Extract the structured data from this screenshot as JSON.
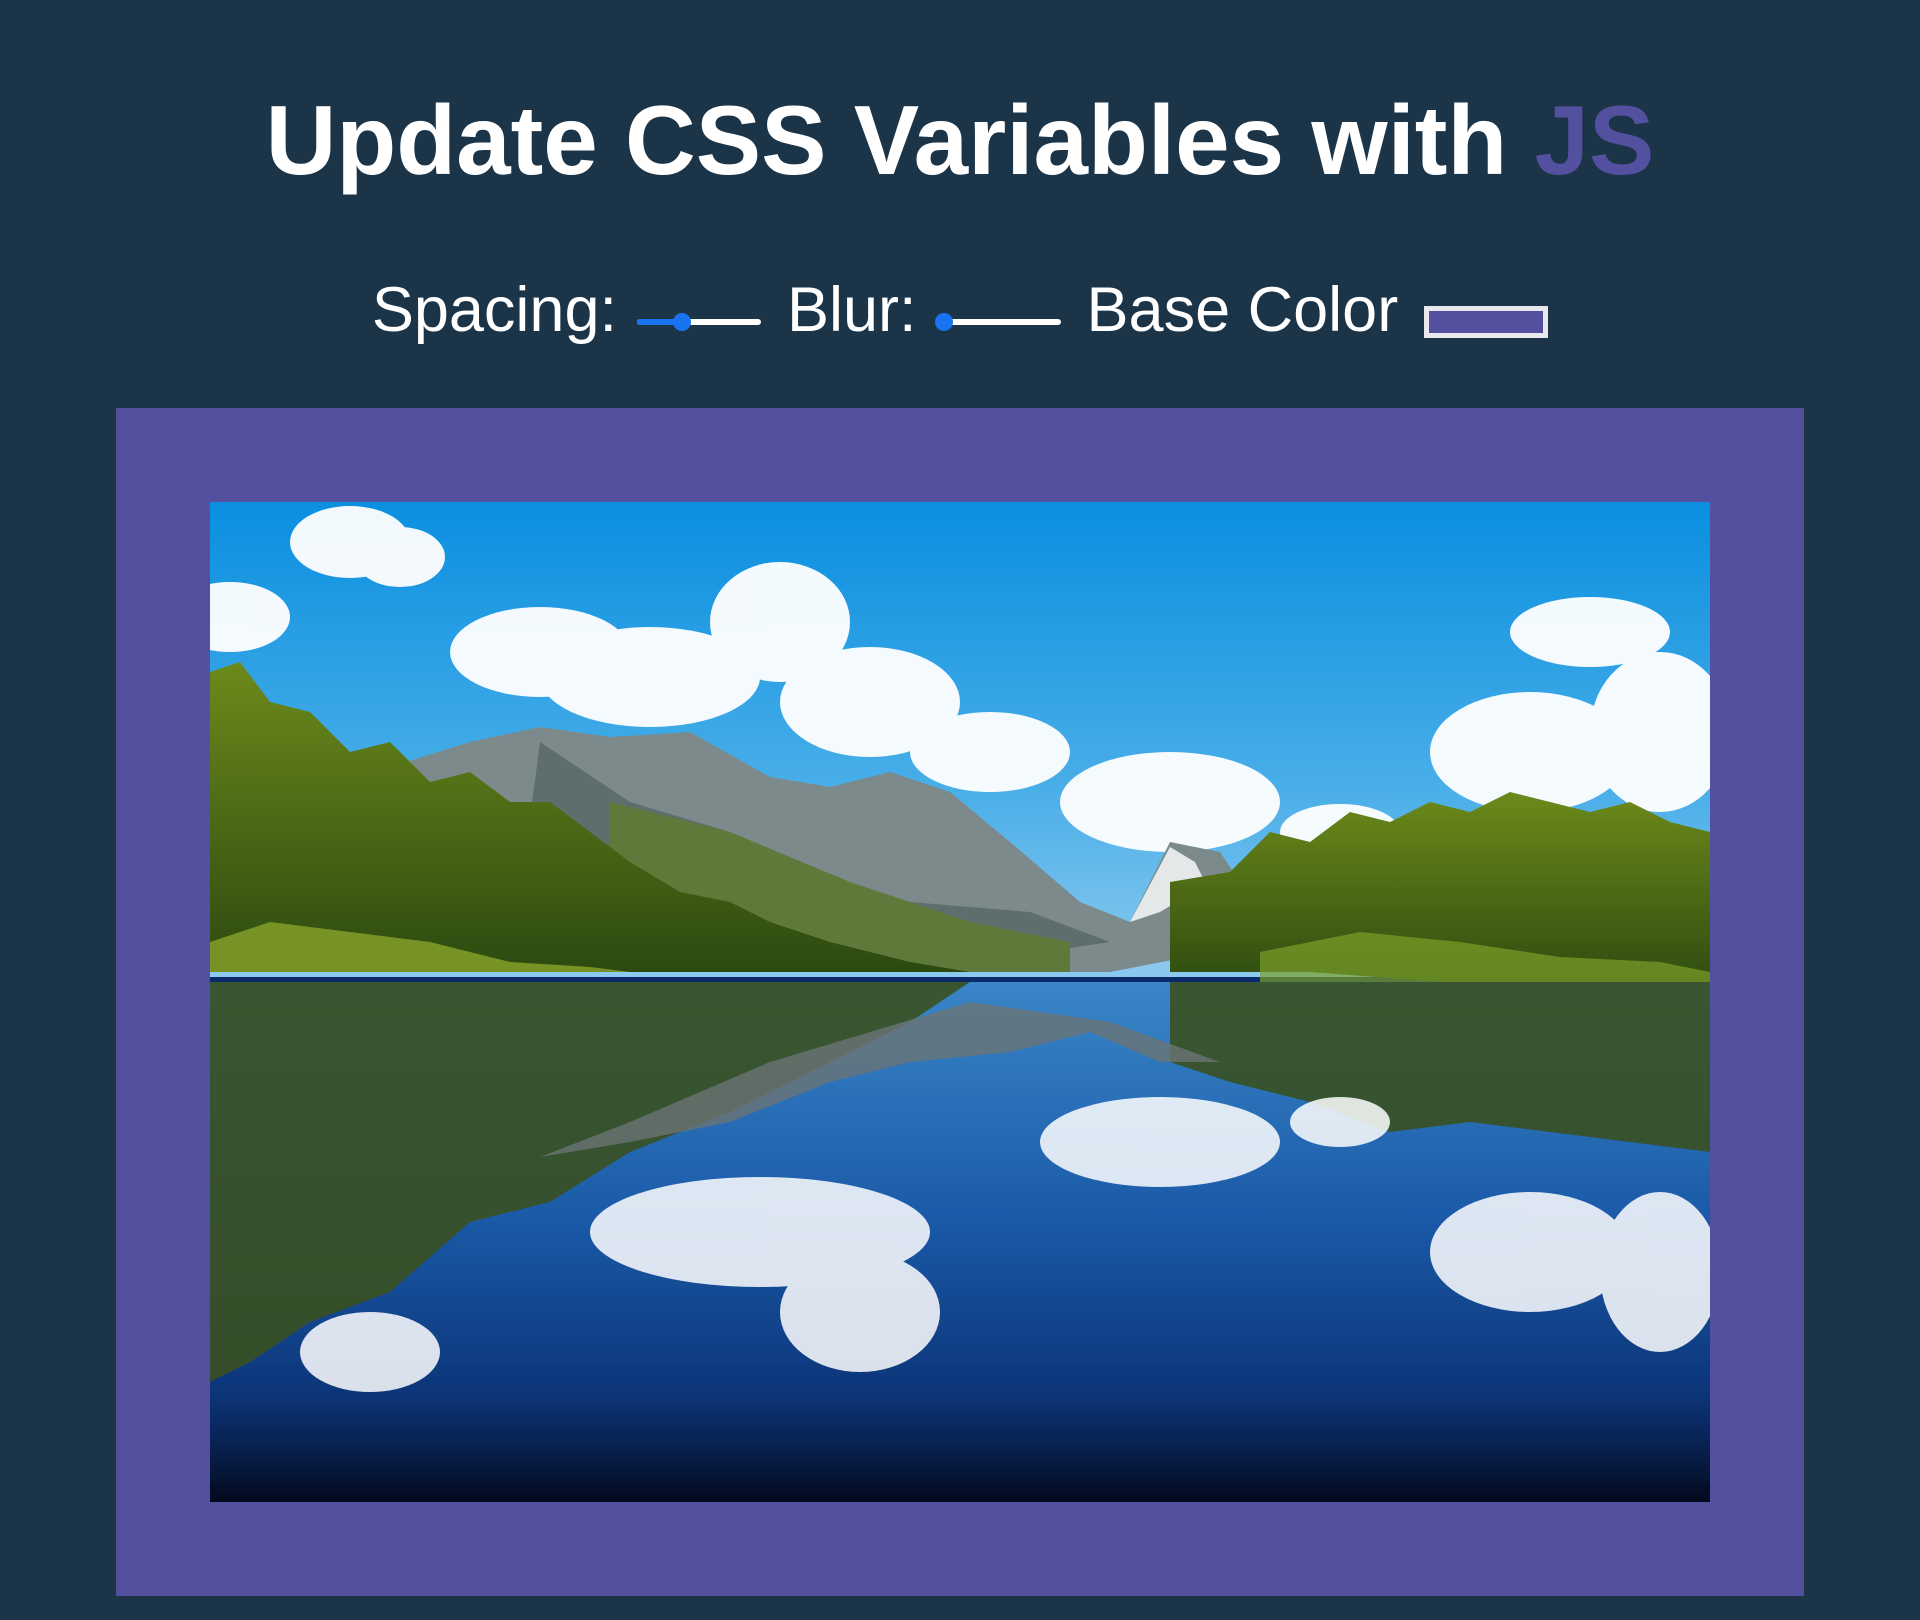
{
  "page": {
    "title_main": "Update CSS Variables with ",
    "title_highlight": "JS"
  },
  "controls": {
    "spacing": {
      "label": "Spacing:",
      "value_fraction": 0.36
    },
    "blur": {
      "label": "Blur:",
      "value_fraction": 0.06
    },
    "base_color": {
      "label": "Base Color",
      "value": "#5450a0"
    }
  },
  "colors": {
    "background": "#1b3448",
    "accent": "#5450a0",
    "slider_active": "#1873f0",
    "text": "#ffffff"
  },
  "image": {
    "subject": "mountain lake landscape with forest and cloud reflections"
  }
}
